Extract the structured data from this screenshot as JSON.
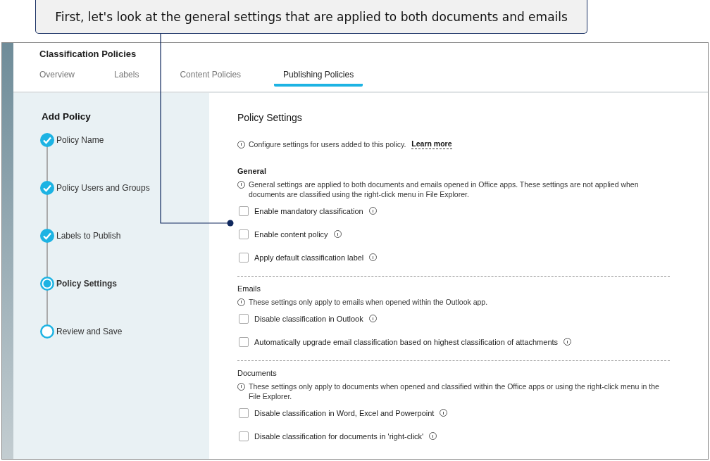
{
  "callout": {
    "text": "First, let's look at the general settings that are applied to both documents and emails"
  },
  "header": {
    "title": "Classification Policies"
  },
  "tabs": [
    {
      "label": "Overview",
      "selected": false
    },
    {
      "label": "Labels",
      "selected": false
    },
    {
      "label": "Content Policies",
      "selected": false
    },
    {
      "label": "Publishing Policies",
      "selected": true
    }
  ],
  "wizard": {
    "title": "Add Policy",
    "steps": [
      {
        "label": "Policy Name",
        "completed": true,
        "current": false
      },
      {
        "label": "Policy Users and Groups",
        "completed": true,
        "current": false
      },
      {
        "label": "Labels to Publish",
        "completed": true,
        "current": false
      },
      {
        "label": "Policy Settings",
        "completed": false,
        "current": true
      },
      {
        "label": "Review and Save",
        "completed": false,
        "current": false
      }
    ]
  },
  "settings": {
    "title": "Policy Settings",
    "intro": "Configure settings for users added to this policy.",
    "link": "Learn more",
    "sections": [
      {
        "title": "General",
        "bold": true,
        "note": "General settings are applied to both documents and emails opened in Office apps. These settings are not applied when documents are classified using the right-click menu in File Explorer.",
        "options": [
          {
            "label": "Enable mandatory classification",
            "checked": false
          },
          {
            "label": "Enable content policy",
            "checked": false
          },
          {
            "label": "Apply default classification label",
            "checked": false
          }
        ]
      },
      {
        "title": "Emails",
        "bold": false,
        "note": "These settings only apply to emails when opened within the Outlook app.",
        "options": [
          {
            "label": "Disable classification in Outlook",
            "checked": false
          },
          {
            "label": "Automatically upgrade email classification based on highest classification of attachments",
            "checked": false
          }
        ]
      },
      {
        "title": "Documents",
        "bold": false,
        "note": "These settings only apply to documents when opened and classified within the Office apps or using the right-click menu in the File Explorer.",
        "options": [
          {
            "label": "Disable classification in Word, Excel and Powerpoint",
            "checked": false
          },
          {
            "label": "Disable classification for documents in 'right-click'",
            "checked": false
          }
        ]
      }
    ]
  }
}
